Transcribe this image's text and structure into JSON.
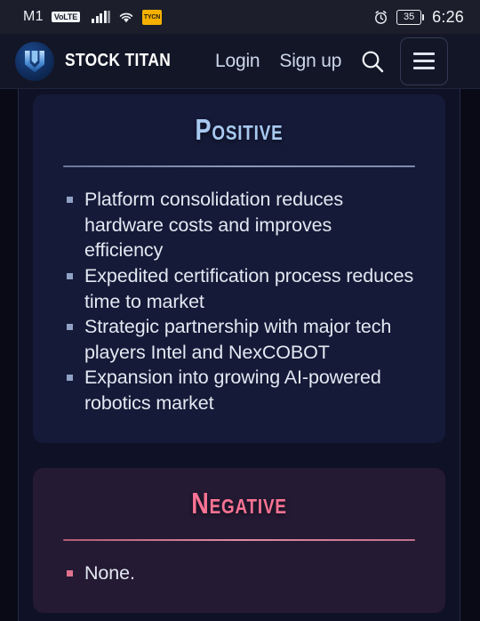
{
  "status_bar": {
    "carrier": "M1",
    "volte_label": "VoLTE",
    "app_badge_label": "TYCN",
    "battery_percent": "35",
    "time": "6:26",
    "icons": {
      "signal": "signal-bars-icon",
      "wifi": "wifi-icon",
      "alarm": "alarm-clock-icon",
      "battery": "battery-icon"
    }
  },
  "header": {
    "brand_name": "STOCK TITAN",
    "logo_icon": "stock-titan-logo-icon",
    "links": [
      {
        "label": "Login",
        "name": "login-link"
      },
      {
        "label": "Sign up",
        "name": "signup-link"
      }
    ],
    "search_icon": "search-icon",
    "menu_icon": "hamburger-menu-icon"
  },
  "main": {
    "cards": [
      {
        "title": "Positive",
        "accent": "#a8c9f0",
        "bullets": [
          "Platform consolidation reduces hardware costs and improves efficiency",
          "Expedited certification process reduces time to market",
          "Strategic partnership with major tech players Intel and NexCOBOT",
          "Expansion into growing AI-powered robotics market"
        ]
      },
      {
        "title": "Negative",
        "accent": "#f97394",
        "bullets": [
          "None."
        ]
      }
    ]
  }
}
